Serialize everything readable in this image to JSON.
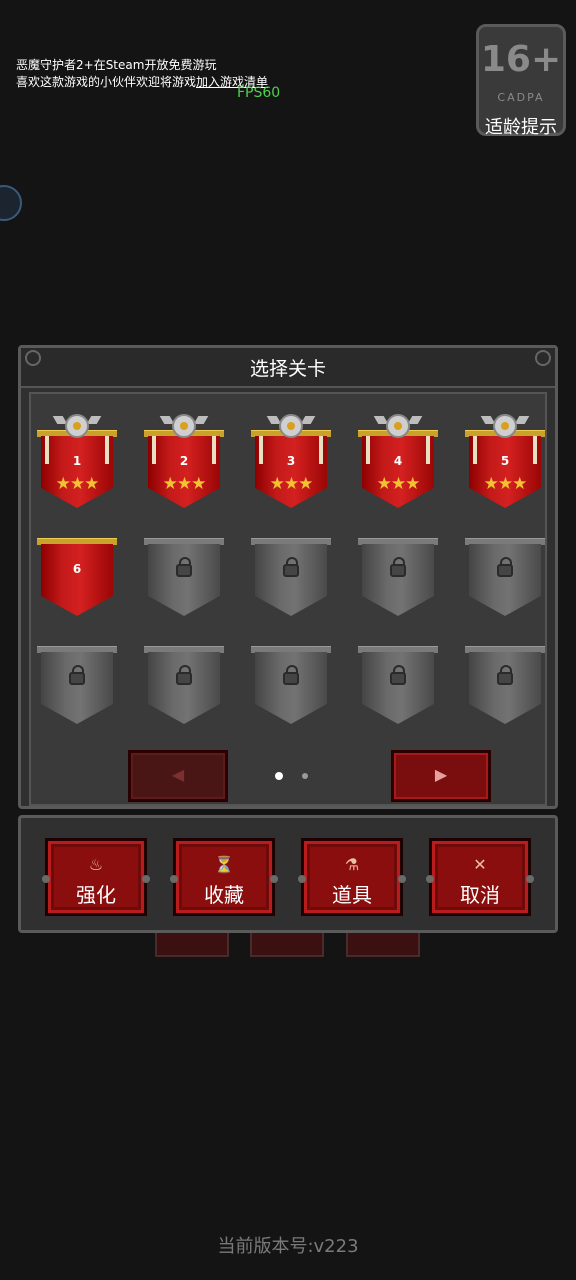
{
  "promo": {
    "line1": "恶魔守护者2+在Steam开放免费游玩",
    "line2_prefix": "喜欢这款游戏的小伙伴欢迎将游戏",
    "line2_link": "加入游戏清单"
  },
  "fps": "FPS60",
  "age_rating": {
    "age": "16+",
    "org": "CADPA",
    "tip": "适龄提示"
  },
  "side_bubble_icon": "player-badge-icon",
  "stage_select": {
    "title": "选择关卡",
    "stages": [
      {
        "label": "1",
        "state": "cleared",
        "stars": "★★★"
      },
      {
        "label": "2",
        "state": "cleared",
        "stars": "★★★"
      },
      {
        "label": "3",
        "state": "cleared",
        "stars": "★★★"
      },
      {
        "label": "4",
        "state": "cleared",
        "stars": "★★★"
      },
      {
        "label": "5",
        "state": "cleared",
        "stars": "★★★"
      },
      {
        "label": "6",
        "state": "unlocked",
        "stars": ""
      },
      {
        "label": "",
        "state": "locked",
        "stars": ""
      },
      {
        "label": "",
        "state": "locked",
        "stars": ""
      },
      {
        "label": "",
        "state": "locked",
        "stars": ""
      },
      {
        "label": "",
        "state": "locked",
        "stars": ""
      },
      {
        "label": "",
        "state": "locked",
        "stars": ""
      },
      {
        "label": "",
        "state": "locked",
        "stars": ""
      },
      {
        "label": "",
        "state": "locked",
        "stars": ""
      },
      {
        "label": "",
        "state": "locked",
        "stars": ""
      },
      {
        "label": "",
        "state": "locked",
        "stars": ""
      }
    ],
    "prev_arrow": "◀",
    "next_arrow": "▶",
    "pages": 2,
    "current_page": 1
  },
  "actions": [
    {
      "icon": "♨",
      "icon_name": "enhance-icon",
      "label": "强化"
    },
    {
      "icon": "⏳",
      "icon_name": "trophy-icon",
      "label": "收藏"
    },
    {
      "icon": "⚗",
      "icon_name": "potion-icon",
      "label": "道具"
    },
    {
      "icon": "✕",
      "icon_name": "cancel-icon",
      "label": "取消"
    }
  ],
  "version": "当前版本号:v223",
  "colors": {
    "accent_red": "#c41a1a",
    "star": "#f2c230",
    "fps": "#4bd24b"
  }
}
